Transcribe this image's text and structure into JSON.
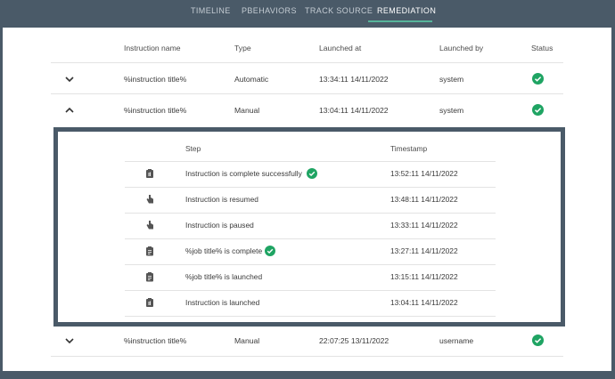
{
  "tabs": [
    {
      "label": "TIMELINE",
      "active": false
    },
    {
      "label": "PBEHAVIORS",
      "active": false
    },
    {
      "label": "TRACK SOURCE",
      "active": false
    },
    {
      "label": "REMEDIATION",
      "active": true
    }
  ],
  "colors": {
    "accent": "#56b49a",
    "frame": "#4a5a68",
    "success": "#1fa463"
  },
  "table": {
    "headers": {
      "name": "Instruction name",
      "type": "Type",
      "launched_at": "Launched at",
      "launched_by": "Launched by",
      "status": "Status"
    },
    "rows": [
      {
        "name": "%instruction title%",
        "type": "Automatic",
        "launched_at": "13:34:11 14/11/2022",
        "launched_by": "system",
        "status": "success",
        "expanded": false
      },
      {
        "name": "%instruction title%",
        "type": "Manual",
        "launched_at": "13:04:11 14/11/2022",
        "launched_by": "system",
        "status": "success",
        "expanded": true
      },
      {
        "name": "%instruction title%",
        "type": "Manual",
        "launched_at": "22:07:25 13/11/2022",
        "launched_by": "username",
        "status": "success",
        "expanded": false
      }
    ]
  },
  "steps": {
    "headers": {
      "step": "Step",
      "timestamp": "Timestamp"
    },
    "rows": [
      {
        "icon": "hand-clipboard-icon",
        "text": "Instruction is complete successfully",
        "check": true,
        "timestamp": "13:52:11 14/11/2022"
      },
      {
        "icon": "hand-pointer-icon",
        "text": "Instruction is resumed",
        "check": false,
        "timestamp": "13:48:11 14/11/2022"
      },
      {
        "icon": "hand-pointer-icon",
        "text": "Instruction is paused",
        "check": false,
        "timestamp": "13:33:11 14/11/2022"
      },
      {
        "icon": "clipboard-icon",
        "text": "%job title% is complete",
        "check": true,
        "timestamp": "13:27:11 14/11/2022"
      },
      {
        "icon": "clipboard-icon",
        "text": "%job title% is launched",
        "check": false,
        "timestamp": "13:15:11 14/11/2022"
      },
      {
        "icon": "hand-clipboard-icon",
        "text": "Instruction is launched",
        "check": false,
        "timestamp": "13:04:11 14/11/2022"
      }
    ]
  }
}
